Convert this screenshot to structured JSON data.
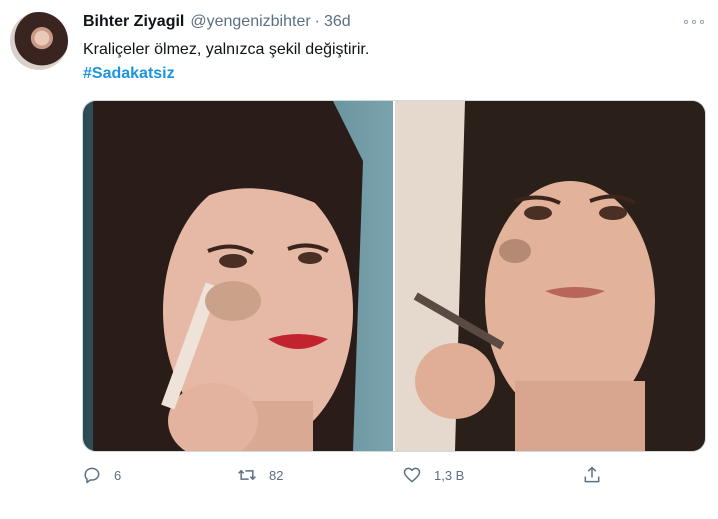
{
  "tweet": {
    "display_name": "Bihter Ziyagil",
    "handle": "@yengenizbihter",
    "separator": "·",
    "time": "36d",
    "text": "Kraliçeler ölmez, yalnızca şekil değiştirir.",
    "hashtag": "#Sadakatsiz"
  },
  "actions": {
    "reply_count": "6",
    "retweet_count": "82",
    "like_count": "1,3 B"
  },
  "colors": {
    "hashtag": "#1b95e0",
    "secondary": "#5b7083",
    "icon": "#5b7083"
  },
  "icons": {
    "reply": "reply-icon",
    "retweet": "retweet-icon",
    "like": "heart-icon",
    "share": "share-icon",
    "more": "more-icon"
  }
}
